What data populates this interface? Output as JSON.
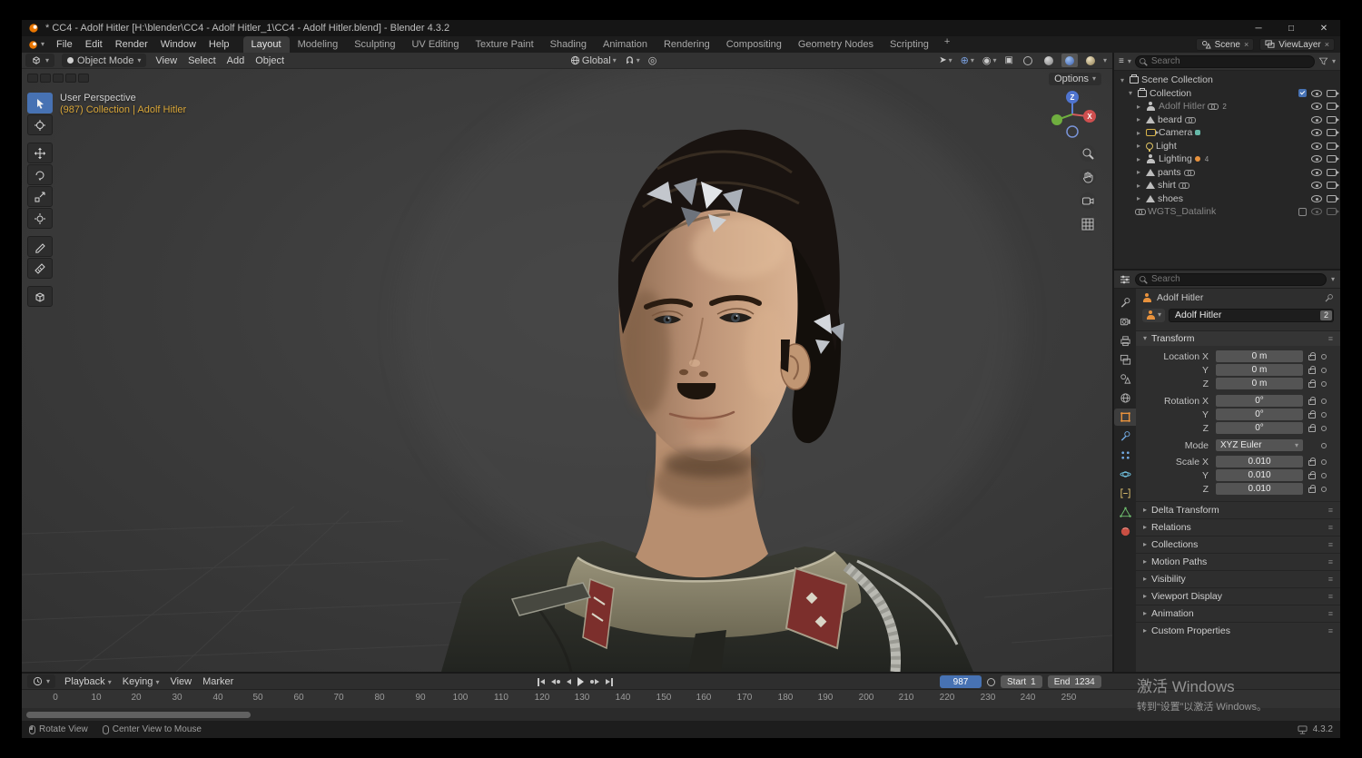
{
  "colors": {
    "accent_blue": "#4772b3",
    "context_orange": "#d8a63a",
    "active_object_orange": "#e8923d"
  },
  "titlebar": {
    "title": "* CC4 - Adolf Hitler [H:\\blender\\CC4 - Adolf Hitler_1\\CC4 - Adolf Hitler.blend] - Blender 4.3.2"
  },
  "menubar": {
    "items": [
      "File",
      "Edit",
      "Render",
      "Window",
      "Help"
    ]
  },
  "workspaces": {
    "tabs": [
      "Layout",
      "Modeling",
      "Sculpting",
      "UV Editing",
      "Texture Paint",
      "Shading",
      "Animation",
      "Rendering",
      "Compositing",
      "Geometry Nodes",
      "Scripting"
    ],
    "add": "+"
  },
  "topbar_right": {
    "scene": "Scene",
    "viewlayer": "ViewLayer"
  },
  "viewport": {
    "header": {
      "mode": "Object Mode",
      "menu_view": "View",
      "menu_select": "Select",
      "menu_add": "Add",
      "menu_object": "Object",
      "orientation": "Global"
    },
    "overlay": {
      "perspective": "User Perspective",
      "context": "(987) Collection | Adolf Hitler",
      "options": "Options"
    },
    "gizmo": {
      "x_label": "X",
      "z_label": "Z"
    }
  },
  "outliner": {
    "search_placeholder": "Search",
    "scene_collection": "Scene Collection",
    "collection": "Collection",
    "items": [
      {
        "label": "Adolf Hitler",
        "badge": "2"
      },
      {
        "label": "beard"
      },
      {
        "label": "Camera"
      },
      {
        "label": "Light"
      },
      {
        "label": "Lighting",
        "badge": "4"
      },
      {
        "label": "pants"
      },
      {
        "label": "shirt"
      },
      {
        "label": "shoes"
      },
      {
        "label": "WGTS_Datalink"
      }
    ]
  },
  "properties": {
    "search_placeholder": "Search",
    "breadcrumb": "Adolf Hitler",
    "name_value": "Adolf Hitler",
    "users_count": "2",
    "transform": {
      "header": "Transform",
      "rows": [
        {
          "label": "Location X",
          "value": "0 m"
        },
        {
          "label": "Y",
          "value": "0 m"
        },
        {
          "label": "Z",
          "value": "0 m"
        },
        {
          "label": "Rotation X",
          "value": "0°"
        },
        {
          "label": "Y",
          "value": "0°"
        },
        {
          "label": "Z",
          "value": "0°"
        },
        {
          "label": "Mode",
          "value": "XYZ Euler"
        },
        {
          "label": "Scale X",
          "value": "0.010"
        },
        {
          "label": "Y",
          "value": "0.010"
        },
        {
          "label": "Z",
          "value": "0.010"
        }
      ]
    },
    "sections": [
      "Delta Transform",
      "Relations",
      "Collections",
      "Motion Paths",
      "Visibility",
      "Viewport Display",
      "Animation",
      "Custom Properties"
    ]
  },
  "timeline": {
    "menus": [
      "Playback",
      "Keying",
      "View",
      "Marker"
    ],
    "current_frame": "987",
    "start_label": "Start",
    "start_value": "1",
    "end_label": "End",
    "end_value": "1234",
    "ticks": [
      "0",
      "10",
      "20",
      "30",
      "40",
      "50",
      "60",
      "70",
      "80",
      "90",
      "100",
      "110",
      "120",
      "130",
      "140",
      "150",
      "160",
      "170",
      "180",
      "190",
      "200",
      "210",
      "220",
      "230",
      "240",
      "250"
    ]
  },
  "statusbar": {
    "hint_rotate": "Rotate View",
    "hint_center": "Center View to Mouse",
    "version": "4.3.2"
  },
  "watermark": {
    "line1": "激活 Windows",
    "line2": "转到“设置”以激活 Windows。"
  }
}
